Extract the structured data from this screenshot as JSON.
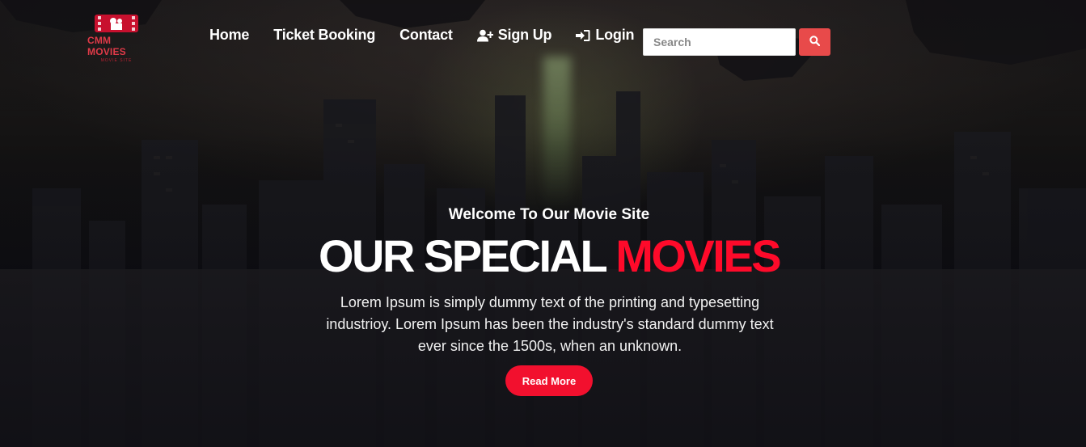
{
  "brand": {
    "name": "CMM MOVIES",
    "tagline": "MOVIE SITE"
  },
  "nav": {
    "home": "Home",
    "ticket_booking": "Ticket Booking",
    "contact": "Contact",
    "sign_up": "Sign Up",
    "login": "Login"
  },
  "search": {
    "placeholder": "Search",
    "value": ""
  },
  "hero": {
    "welcome": "Welcome To Our Movie Site",
    "headline_main": "OUR SPECIAL",
    "headline_accent": "MOVIES",
    "description": "Lorem Ipsum is simply dummy text of the printing and typesetting industrioy. Lorem Ipsum has been the industry's standard dummy text ever since the 1500s, when an unknown.",
    "button": "Read More"
  },
  "colors": {
    "accent": "#ff0a2a",
    "search_button": "#e84a4a",
    "logo": "#c8102e"
  },
  "icons": {
    "sign_up": "user-plus-icon",
    "login": "sign-in-icon",
    "search": "search-icon"
  }
}
